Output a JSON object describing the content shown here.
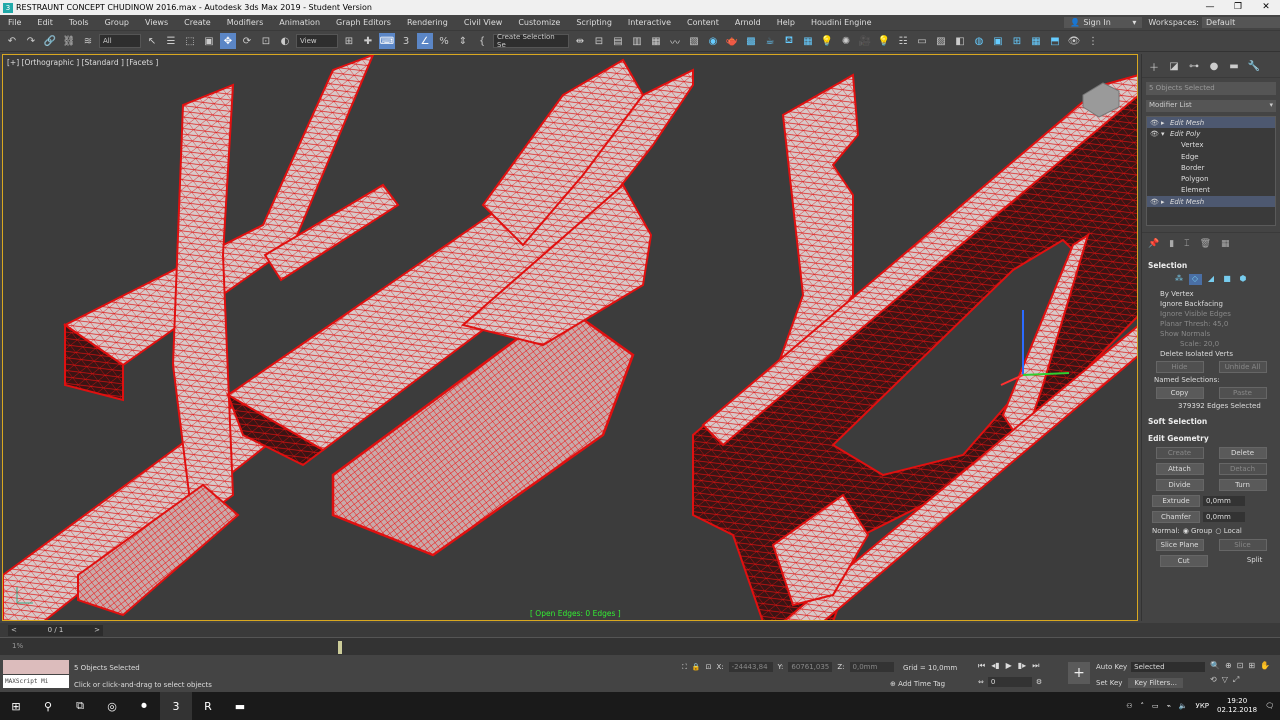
{
  "window": {
    "title": "RESTRAUNT CONCEPT CHUDINOW 2016.max - Autodesk 3ds Max 2019 - Student Version",
    "app_icon": "3"
  },
  "menu": [
    "File",
    "Edit",
    "Tools",
    "Group",
    "Views",
    "Create",
    "Modifiers",
    "Animation",
    "Graph Editors",
    "Rendering",
    "Civil View",
    "Customize",
    "Scripting",
    "Interactive",
    "Content",
    "Arnold",
    "Help",
    "Houdini Engine"
  ],
  "account": {
    "sign_in": "Sign In",
    "workspaces_label": "Workspaces:",
    "workspace": "Default"
  },
  "toolbar": {
    "filter": "All",
    "ref_coord": "View",
    "selection_set": "Create Selection Se",
    "snap_value": "3"
  },
  "viewport": {
    "label": "[+] [Orthographic ] [Standard ] [Facets ]",
    "status": "[ Open Edges: 0 Edges ]"
  },
  "command_panel": {
    "object_name": "5 Objects Selected",
    "modifier_list": "Modifier List",
    "stack": [
      {
        "label": "Edit Mesh",
        "level": 0,
        "italic": true,
        "highlight": true
      },
      {
        "label": "Edit Poly",
        "level": 0,
        "italic": true,
        "highlight": false,
        "expanded": true
      },
      {
        "label": "Vertex",
        "level": 1
      },
      {
        "label": "Edge",
        "level": 1
      },
      {
        "label": "Border",
        "level": 1
      },
      {
        "label": "Polygon",
        "level": 1
      },
      {
        "label": "Element",
        "level": 1
      },
      {
        "label": "Edit Mesh",
        "level": 0,
        "italic": true,
        "highlight": true
      }
    ],
    "selection": {
      "title": "Selection",
      "by_vertex": "By Vertex",
      "ignore_backfacing": "Ignore Backfacing",
      "ignore_visible_edges": "Ignore Visible Edges",
      "planar_thresh_label": "Planar Thresh:",
      "planar_thresh": "45,0",
      "show_normals": "Show Normals",
      "scale_label": "Scale:",
      "scale": "20,0",
      "delete_isolated": "Delete Isolated Verts",
      "hide": "Hide",
      "unhide_all": "Unhide All",
      "named_selections": "Named Selections:",
      "copy": "Copy",
      "paste": "Paste",
      "summary": "379392 Edges Selected"
    },
    "soft_selection": "Soft Selection",
    "edit_geometry": {
      "title": "Edit Geometry",
      "create": "Create",
      "delete": "Delete",
      "attach": "Attach",
      "detach": "Detach",
      "divide": "Divide",
      "turn": "Turn",
      "extrude": "Extrude",
      "extrude_val": "0,0mm",
      "chamfer": "Chamfer",
      "chamfer_val": "0,0mm",
      "normal_label": "Normal:",
      "group": "Group",
      "local": "Local",
      "slice_plane": "Slice Plane",
      "slice": "Slice",
      "cut": "Cut",
      "split": "Split"
    }
  },
  "timeline": {
    "frame": "0 / 1"
  },
  "status": {
    "maxscript": "MAXScript Mi",
    "selected": "5 Objects Selected",
    "prompt": "Click or click-and-drag to select objects",
    "x_label": "X:",
    "x": "-24443,84",
    "y_label": "Y:",
    "y": "60761,035",
    "z_label": "Z:",
    "z": "0,0mm",
    "grid": "Grid = 10,0mm",
    "add_time_tag": "Add Time Tag",
    "frame_field": "0",
    "auto_key": "Auto Key",
    "key_mode": "Selected",
    "set_key": "Set Key",
    "key_filters": "Key Filters..."
  },
  "taskbar": {
    "lang": "УКР",
    "time": "19:20",
    "date": "02.12.2018"
  },
  "colors": {
    "wire": "#e01010",
    "selection_highlight": "#5b86c6",
    "viewport_border": "#d9a820"
  }
}
